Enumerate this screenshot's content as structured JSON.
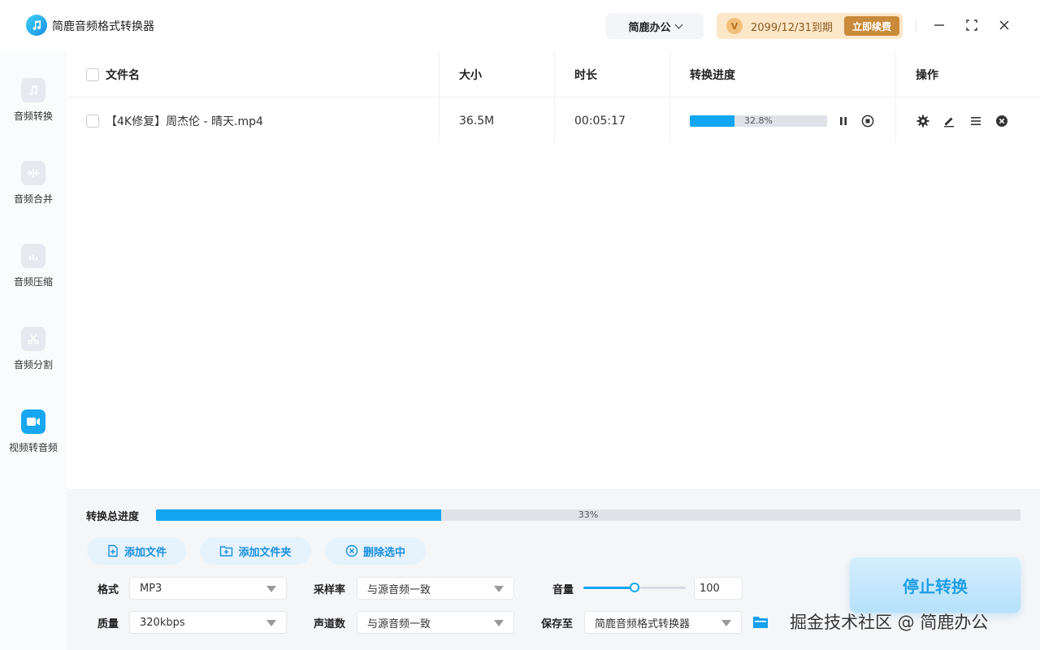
{
  "app": {
    "title": "简鹿音频格式转换器",
    "account_label": "简鹿办公",
    "vip_expiry": "2099/12/31到期",
    "renew_label": "立即续费"
  },
  "sidebar": {
    "items": [
      {
        "label": "音频转换",
        "icon": "music-note-icon",
        "active": false
      },
      {
        "label": "音频合并",
        "icon": "merge-icon",
        "active": false
      },
      {
        "label": "音频压缩",
        "icon": "compress-icon",
        "active": false
      },
      {
        "label": "音频分割",
        "icon": "scissors-icon",
        "active": false
      },
      {
        "label": "视频转音频",
        "icon": "video-camera-icon",
        "active": true
      }
    ]
  },
  "table": {
    "headers": {
      "name": "文件名",
      "size": "大小",
      "duration": "时长",
      "progress": "转换进度",
      "actions": "操作"
    },
    "rows": [
      {
        "name": "【4K修复】周杰伦 - 晴天.mp4",
        "size": "36.5M",
        "duration": "00:05:17",
        "progress_text": "32.8%",
        "progress": 0.328
      }
    ]
  },
  "total": {
    "label": "转换总进度",
    "text": "33%",
    "progress": 0.33
  },
  "actions": {
    "add_file": "添加文件",
    "add_folder": "添加文件夹",
    "delete_selected": "删除选中"
  },
  "settings": {
    "format_label": "格式",
    "format_value": "MP3",
    "quality_label": "质量",
    "quality_value": "320kbps",
    "sample_rate_label": "采样率",
    "sample_rate_value": "与源音频一致",
    "channels_label": "声道数",
    "channels_value": "与源音频一致",
    "volume_label": "音量",
    "volume_value": "100",
    "volume_level": 0.5,
    "save_label": "保存至",
    "save_value": "简鹿音频格式转换器"
  },
  "stop_label": "停止转换",
  "watermark": "掘金技术社区 @ 简鹿办公",
  "colors": {
    "accent": "#12a6f2",
    "vip_bg": "#fde7c9",
    "renew": "#c98a3a"
  }
}
